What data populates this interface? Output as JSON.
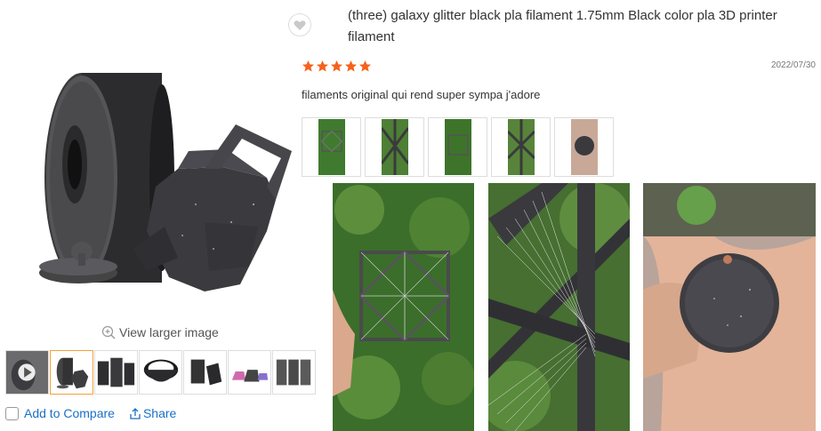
{
  "gallery": {
    "view_larger_label": "View larger image",
    "thumbnails": [
      {
        "name": "video",
        "selected": false
      },
      {
        "name": "spool-pot",
        "selected": true
      },
      {
        "name": "towers",
        "selected": false
      },
      {
        "name": "bowl",
        "selected": false
      },
      {
        "name": "vase",
        "selected": false
      },
      {
        "name": "colored-pots",
        "selected": false
      },
      {
        "name": "grey-parts",
        "selected": false
      }
    ],
    "compare_label": "Add to Compare",
    "share_label": "Share",
    "icons": [
      "zoom-icon",
      "play-icon",
      "share-icon",
      "checkbox-icon"
    ]
  },
  "review": {
    "title": "(three) galaxy glitter black pla filament 1.75mm Black color pla 3D printer filament",
    "rating": 5,
    "rating_max": 5,
    "date": "2022/07/30",
    "text": "filaments original qui rend super sympa j'adore",
    "thumbnail_count": 5,
    "photo_count": 3,
    "icons": [
      "heart-icon",
      "star-icon"
    ]
  },
  "colors": {
    "star": "#f5621e",
    "link": "#1a6fc5",
    "selected_border": "#f0a23b",
    "text": "#333333"
  }
}
